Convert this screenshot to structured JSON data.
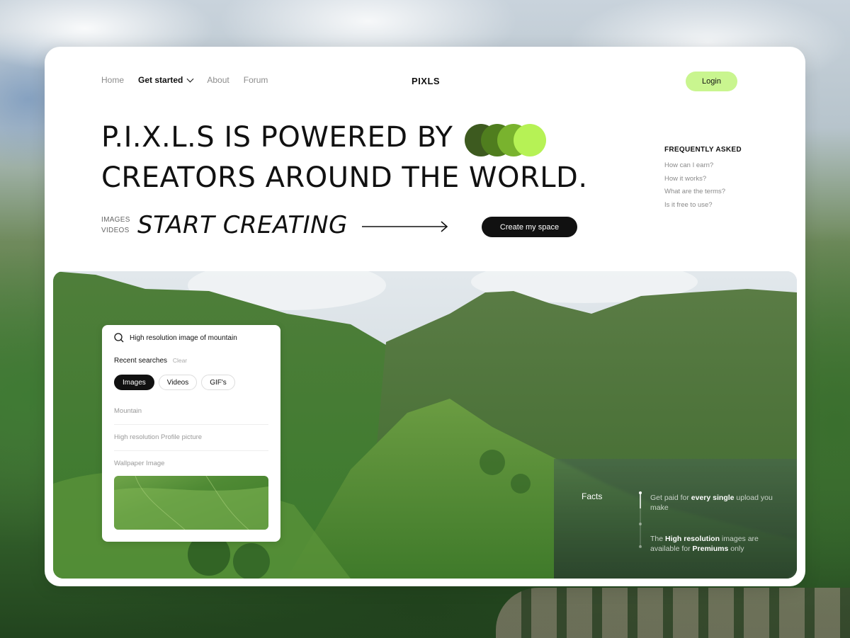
{
  "nav": {
    "items": [
      "Home",
      "Get started",
      "About",
      "Forum"
    ],
    "brand": "PIXLS",
    "login_label": "Login"
  },
  "hero": {
    "headline_line1": "P.I.X.L.S IS POWERED BY",
    "headline_line2": "CREATORS AROUND THE WORLD.",
    "media_types": [
      "IMAGES",
      "VIDEOS"
    ],
    "cta_text": "START CREATING",
    "create_button": "Create my space"
  },
  "faq": {
    "title": "FREQUENTLY ASKED",
    "items": [
      "How can I earn?",
      "How it works?",
      "What are the terms?",
      "Is it free to use?"
    ]
  },
  "search": {
    "query": "High resolution image of mountain",
    "recent_label": "Recent searches",
    "clear_label": "Clear",
    "filters": [
      "Images",
      "Videos",
      "GIF's"
    ],
    "active_filter": "Images",
    "recent_items": [
      "Mountain",
      "High resolution Profile picture",
      "Wallpaper Image"
    ]
  },
  "facts": {
    "title": "Facts",
    "fact1": {
      "pre": "Get paid for ",
      "bold": "every single",
      "post": " upload you make"
    },
    "fact2": {
      "pre": "The ",
      "bold": "High resolution",
      "mid": " images are available for ",
      "bold2": "Premiums",
      "post": " only"
    }
  },
  "colors": {
    "accent_green": "#c9f58f",
    "dot_colors": [
      "#3d5a1f",
      "#4f7d1e",
      "#79b32e",
      "#b6f255"
    ]
  }
}
